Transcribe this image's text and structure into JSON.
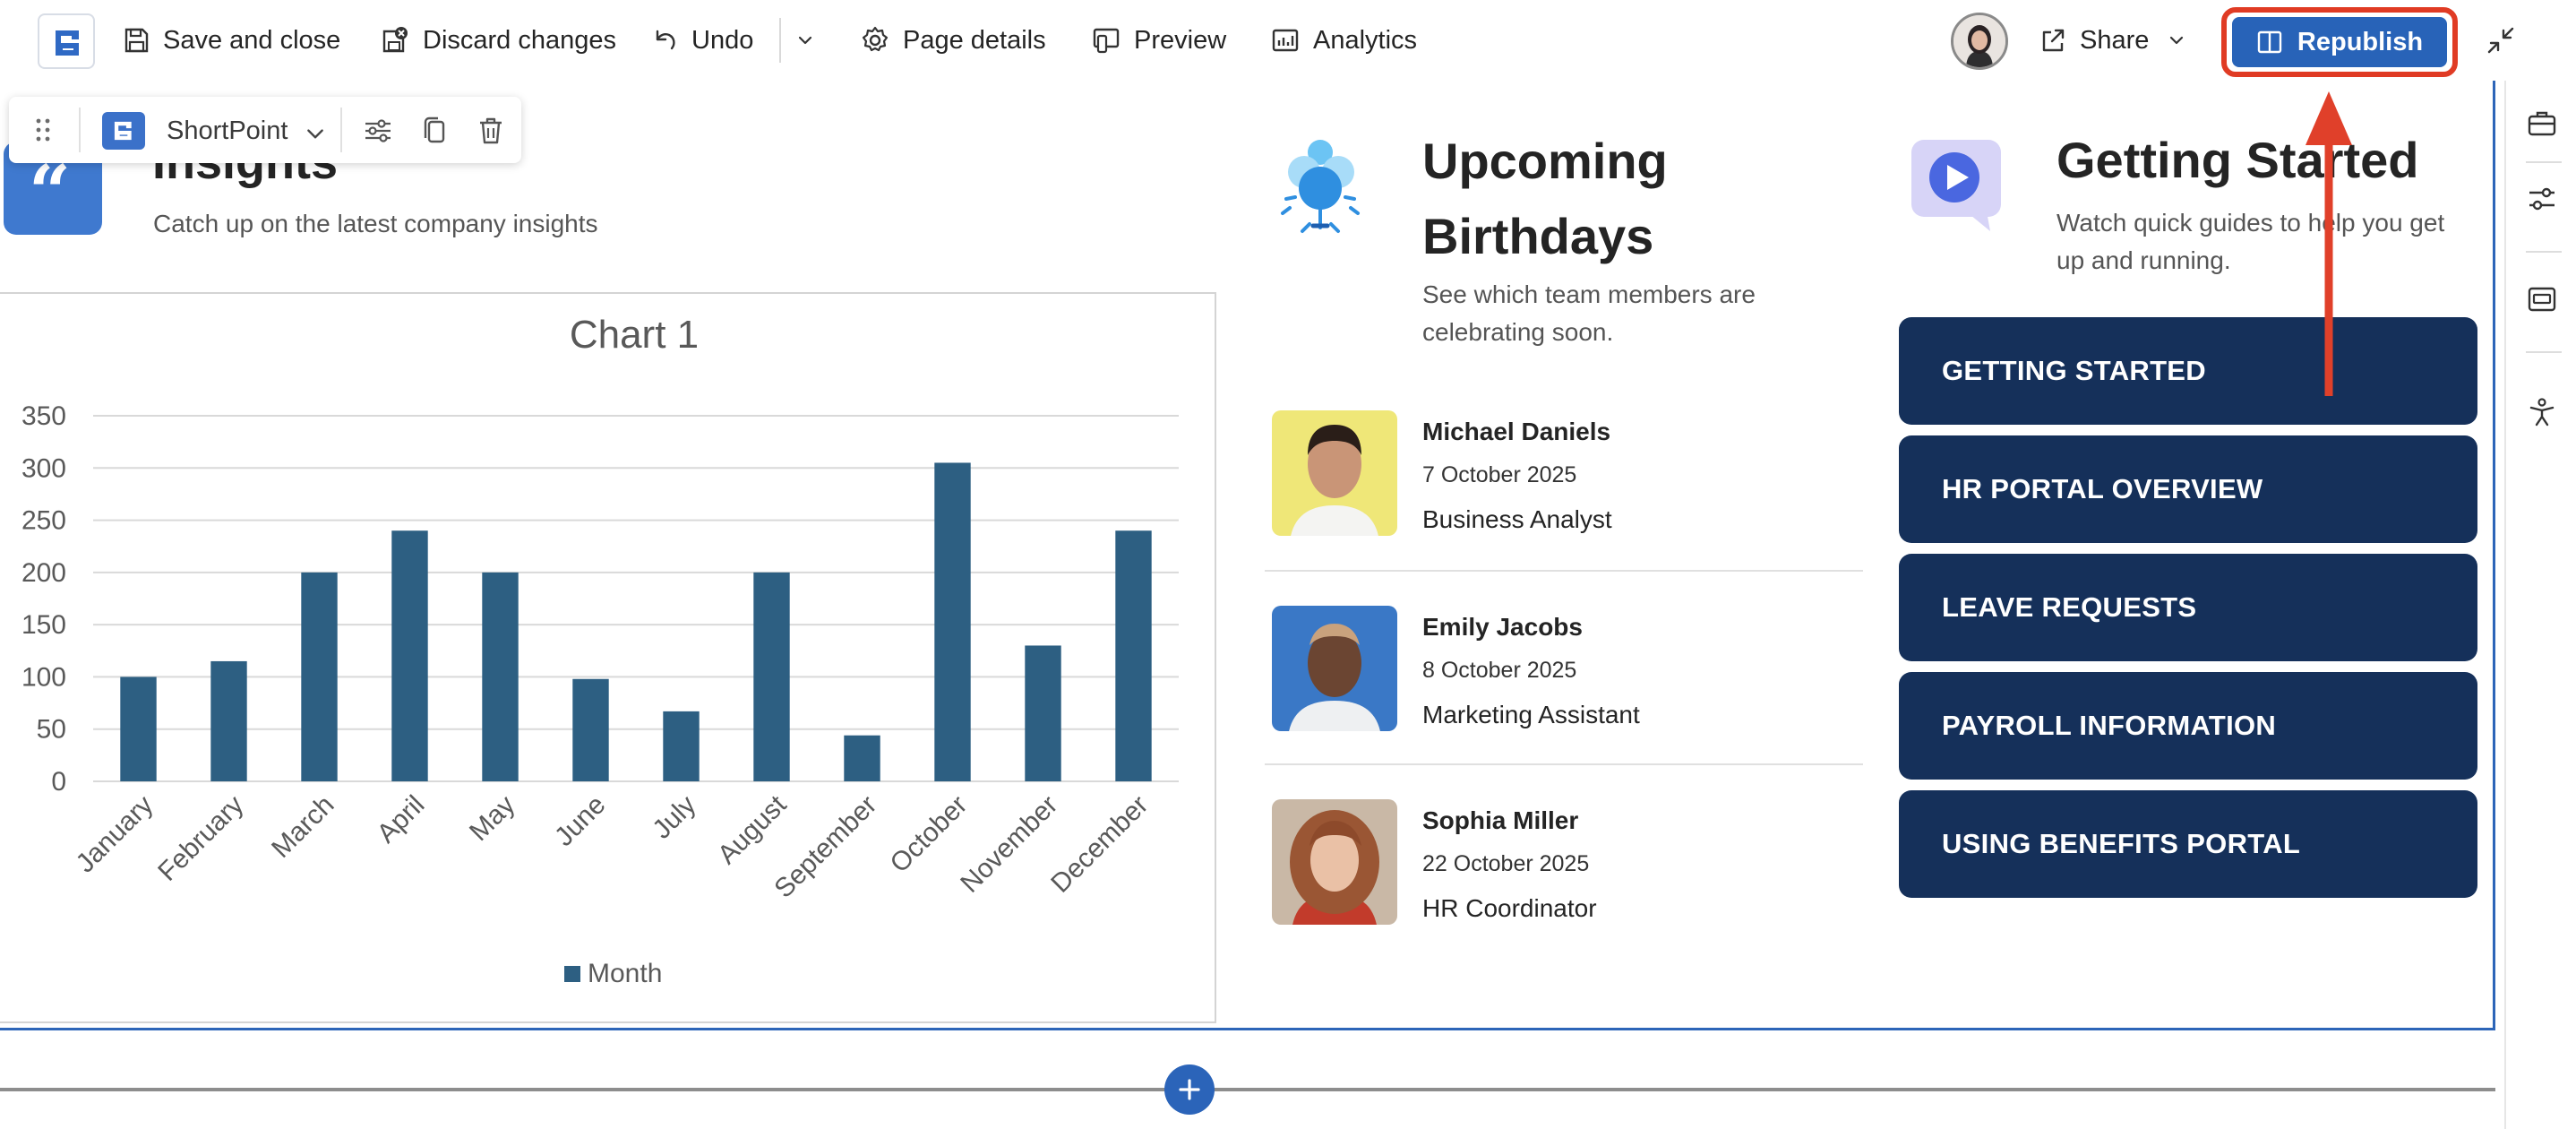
{
  "toolbar": {
    "save_close": "Save and close",
    "discard": "Discard changes",
    "undo": "Undo",
    "page_details": "Page details",
    "preview": "Preview",
    "analytics": "Analytics",
    "share": "Share",
    "republish": "Republish"
  },
  "float_toolbar": {
    "label": "ShortPoint"
  },
  "insights": {
    "title": "Insights",
    "subtitle": "Catch up on the latest company insights"
  },
  "chart_data": {
    "type": "bar",
    "title": "Chart 1",
    "categories": [
      "January",
      "February",
      "March",
      "April",
      "May",
      "June",
      "July",
      "August",
      "September",
      "October",
      "November",
      "December"
    ],
    "series": [
      {
        "name": "Month",
        "values": [
          100,
          115,
          200,
          240,
          200,
          98,
          67,
          200,
          44,
          305,
          130,
          240
        ]
      }
    ],
    "ylim": [
      0,
      350
    ],
    "yticks": [
      0,
      50,
      100,
      150,
      200,
      250,
      300,
      350
    ],
    "grid": true,
    "legend": "bottom",
    "color": "#2d5f82"
  },
  "birthdays": {
    "title_line1": "Upcoming",
    "title_line2": "Birthdays",
    "subtitle": "See which team members are celebrating soon.",
    "people": [
      {
        "name": "Michael Daniels",
        "date": "7 October 2025",
        "role": "Business Analyst"
      },
      {
        "name": "Emily Jacobs",
        "date": "8 October 2025",
        "role": "Marketing Assistant"
      },
      {
        "name": "Sophia Miller",
        "date": "22 October 2025",
        "role": "HR Coordinator"
      }
    ]
  },
  "getting_started": {
    "title": "Getting Started",
    "subtitle": "Watch quick guides to help you get up and running.",
    "buttons": [
      "GETTING STARTED",
      "HR PORTAL OVERVIEW",
      "LEAVE REQUESTS",
      "PAYROLL INFORMATION",
      "USING BENEFITS PORTAL"
    ]
  },
  "colors": {
    "accent": "#2863b8",
    "highlight": "#e03b24",
    "button_dark": "#15305a"
  }
}
